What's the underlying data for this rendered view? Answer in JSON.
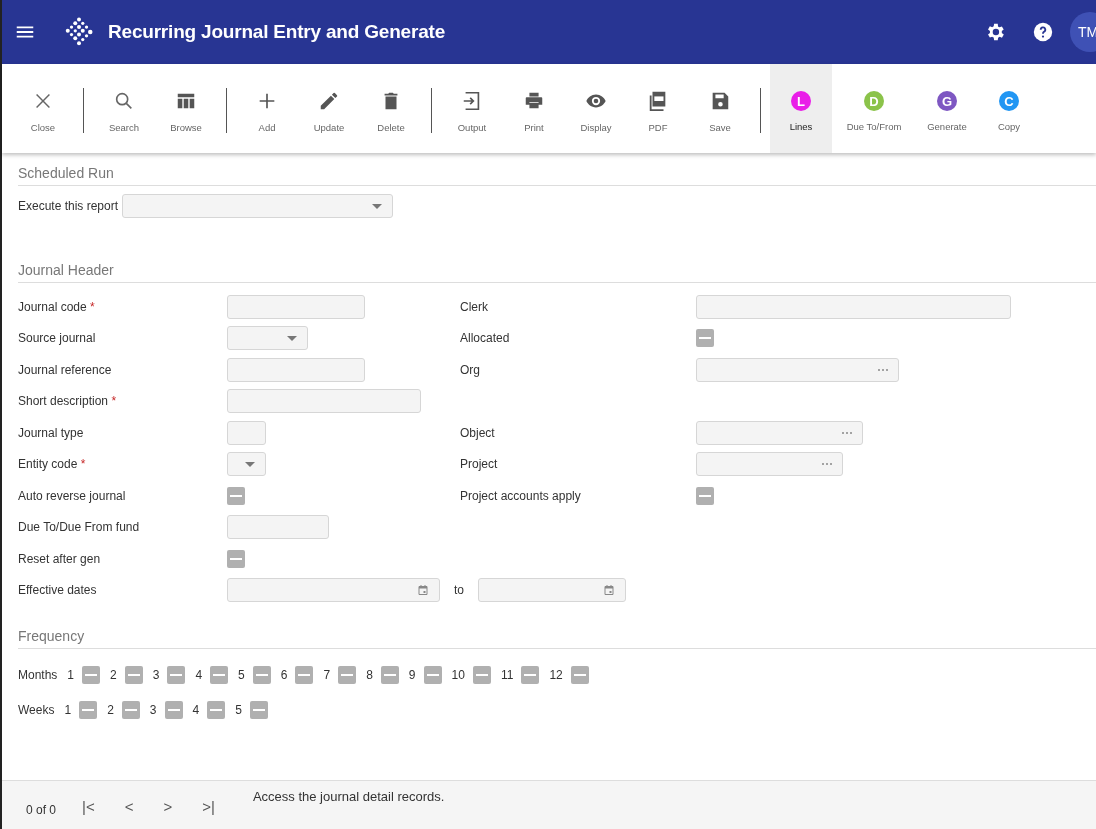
{
  "header": {
    "title": "Recurring Journal Entry and Generate",
    "avatar": "TM"
  },
  "toolbar": [
    {
      "kind": "icon",
      "label": "Close",
      "selected": false
    },
    {
      "kind": "divider"
    },
    {
      "kind": "icon",
      "label": "Search",
      "selected": false
    },
    {
      "kind": "icon",
      "label": "Browse",
      "selected": false
    },
    {
      "kind": "divider"
    },
    {
      "kind": "icon",
      "label": "Add",
      "selected": false
    },
    {
      "kind": "icon",
      "label": "Update",
      "selected": false
    },
    {
      "kind": "icon",
      "label": "Delete",
      "selected": false
    },
    {
      "kind": "divider"
    },
    {
      "kind": "icon",
      "label": "Output",
      "selected": false
    },
    {
      "kind": "icon",
      "label": "Print",
      "selected": false
    },
    {
      "kind": "icon",
      "label": "Display",
      "selected": false
    },
    {
      "kind": "icon",
      "label": "PDF",
      "selected": false
    },
    {
      "kind": "icon",
      "label": "Save",
      "selected": false
    },
    {
      "kind": "divider"
    },
    {
      "kind": "badge",
      "letter": "L",
      "color": "#e91ee8",
      "label": "Lines",
      "selected": true
    },
    {
      "kind": "badge",
      "letter": "D",
      "color": "#8bc34a",
      "label": "Due To/From",
      "selected": false
    },
    {
      "kind": "badge",
      "letter": "G",
      "color": "#7e57c2",
      "label": "Generate",
      "selected": false
    },
    {
      "kind": "badge",
      "letter": "C",
      "color": "#2196f3",
      "label": "Copy",
      "selected": false
    }
  ],
  "scheduled_run": {
    "title": "Scheduled Run",
    "label": "Execute this report"
  },
  "journal_header": {
    "title": "Journal Header",
    "rows": [
      {
        "left": {
          "label": "Journal code",
          "required": "*",
          "kind": "text"
        },
        "right": {
          "label": "Clerk",
          "kind": "text"
        }
      },
      {
        "left": {
          "label": "Source journal",
          "kind": "select"
        },
        "right": {
          "label": "Allocated",
          "kind": "checkbox",
          "indeterminate": true
        }
      },
      {
        "left": {
          "label": "Journal reference",
          "kind": "text"
        },
        "right": {
          "label": "Org",
          "kind": "lookup"
        }
      },
      {
        "left": {
          "label": "Short description",
          "required": "*",
          "kind": "text"
        }
      },
      {
        "left": {
          "label": "Journal type",
          "kind": "text"
        },
        "right": {
          "label": "Object",
          "kind": "lookup"
        }
      },
      {
        "left": {
          "label": "Entity code",
          "required": "*",
          "kind": "select"
        },
        "right": {
          "label": "Project",
          "kind": "lookup"
        }
      },
      {
        "left": {
          "label": "Auto reverse journal",
          "kind": "checkbox",
          "indeterminate": true
        },
        "right": {
          "label": "Project accounts apply",
          "kind": "checkbox",
          "indeterminate": true
        }
      },
      {
        "left": {
          "label": "Due To/Due From fund",
          "kind": "text"
        }
      },
      {
        "left": {
          "label": "Reset after gen",
          "kind": "checkbox",
          "indeterminate": true
        }
      },
      {
        "left": {
          "label": "Effective dates",
          "kind": "daterange",
          "between": "to"
        }
      }
    ]
  },
  "frequency": {
    "title": "Frequency",
    "rows": [
      {
        "label": "Months",
        "items": [
          {
            "number": "1",
            "indeterminate": true
          },
          {
            "number": "2",
            "indeterminate": true
          },
          {
            "number": "3",
            "indeterminate": true
          },
          {
            "number": "4",
            "indeterminate": true
          },
          {
            "number": "5",
            "indeterminate": true
          },
          {
            "number": "6",
            "indeterminate": true
          },
          {
            "number": "7",
            "indeterminate": true
          },
          {
            "number": "8",
            "indeterminate": true
          },
          {
            "number": "9",
            "indeterminate": true
          },
          {
            "number": "10",
            "indeterminate": true
          },
          {
            "number": "11",
            "indeterminate": true
          },
          {
            "number": "12",
            "indeterminate": true
          }
        ]
      },
      {
        "label": "Weeks",
        "items": [
          {
            "number": "1",
            "indeterminate": true
          },
          {
            "number": "2",
            "indeterminate": true
          },
          {
            "number": "3",
            "indeterminate": true
          },
          {
            "number": "4",
            "indeterminate": true
          },
          {
            "number": "5",
            "indeterminate": true
          }
        ]
      }
    ]
  },
  "footer": {
    "record_count": "0 of 0",
    "first": "|<",
    "previous": "<",
    "next": ">",
    "last": ">|",
    "message": "Access the journal detail records."
  }
}
